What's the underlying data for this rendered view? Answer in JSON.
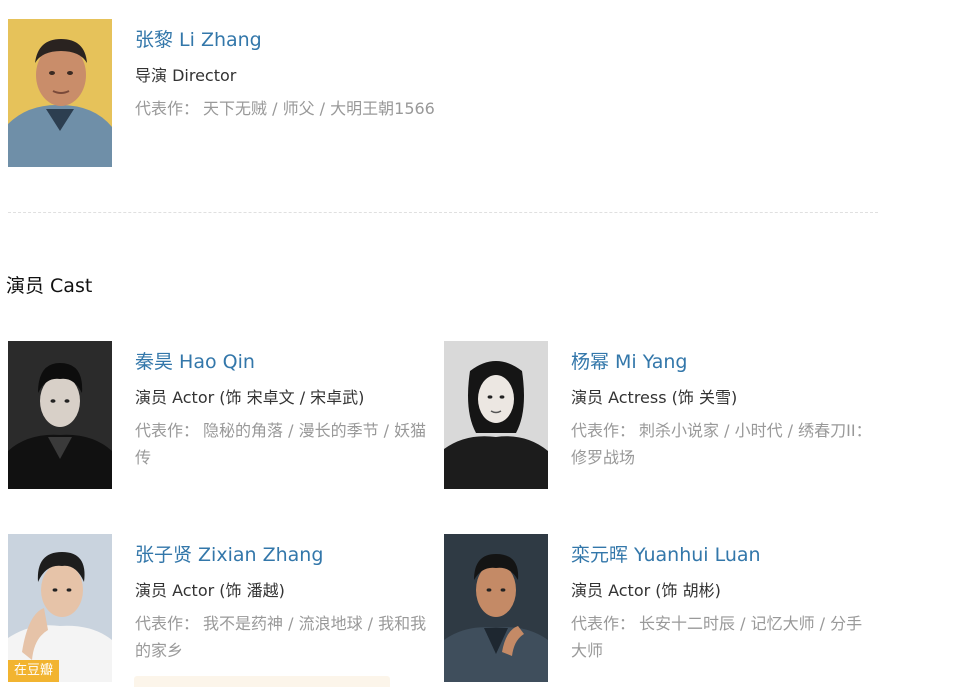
{
  "director": {
    "name": "张黎 Li Zhang",
    "role": "导演 Director",
    "works_label": "代表作：",
    "works": "天下无贼 / 师父 / 大明王朝1566"
  },
  "cast_section": {
    "title": "演员 Cast"
  },
  "cast": [
    {
      "name": "秦昊 Hao Qin",
      "role": "演员 Actor (饰 宋卓文 / 宋卓武)",
      "works_label": "代表作：",
      "works": "隐秘的角落 / 漫长的季节 / 妖猫传"
    },
    {
      "name": "杨幂 Mi Yang",
      "role": "演员 Actress (饰 关雪)",
      "works_label": "代表作：",
      "works": "刺杀小说家 / 小时代 / 绣春刀II：修罗战场"
    },
    {
      "name": "张子贤 Zixian Zhang",
      "role": "演员 Actor (饰 潘越)",
      "works_label": "代表作：",
      "works": "我不是药神 / 流浪地球 / 我和我的家乡",
      "badge": "在豆瓣"
    },
    {
      "name": "栾元晖 Yuanhui Luan",
      "role": "演员 Actor (饰 胡彬)",
      "works_label": "代表作：",
      "works": "长安十二时辰 / 记忆大师 / 分手大师"
    }
  ]
}
